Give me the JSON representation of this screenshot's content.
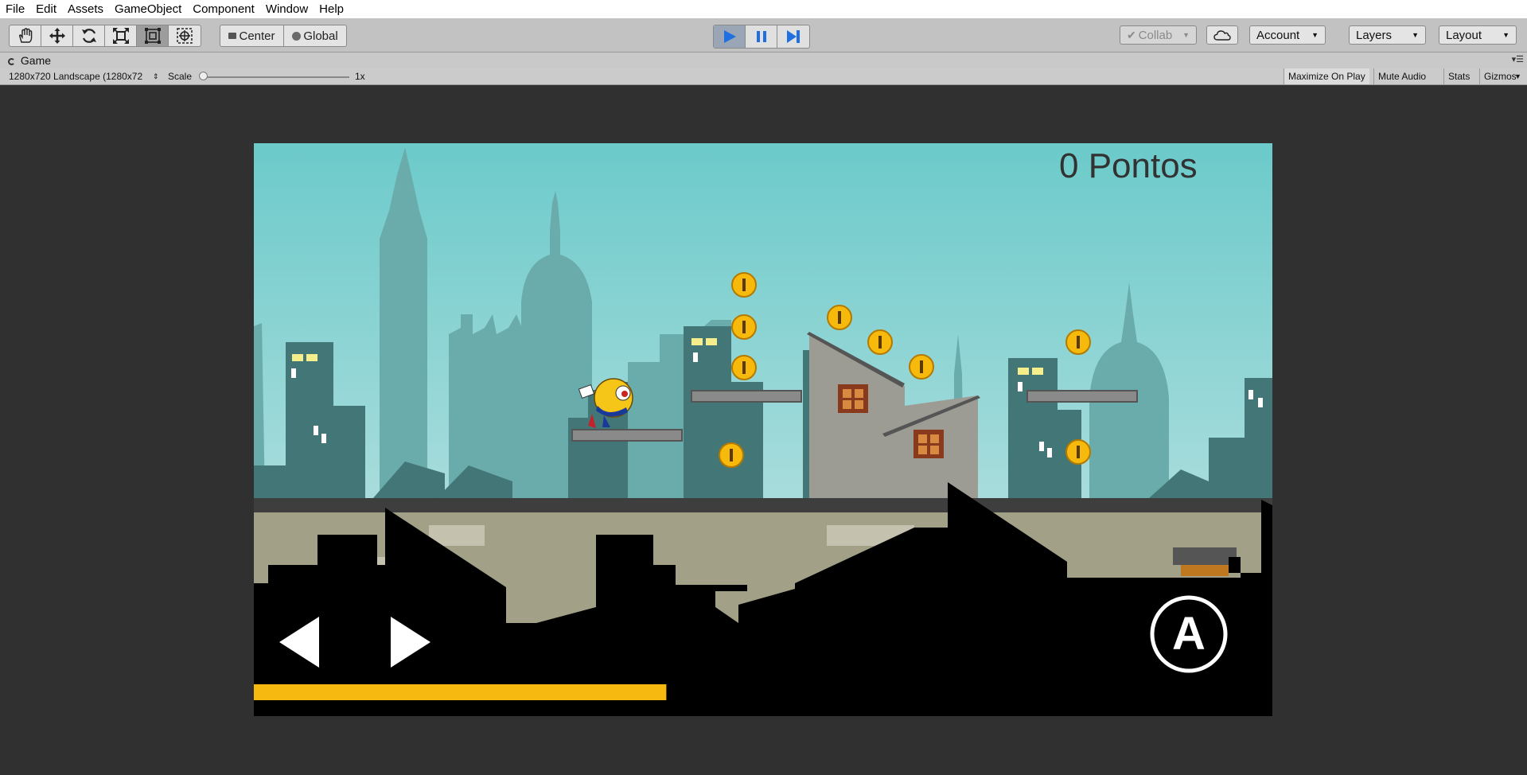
{
  "menu": [
    "File",
    "Edit",
    "Assets",
    "GameObject",
    "Component",
    "Window",
    "Help"
  ],
  "toolbar": {
    "tools": [
      {
        "icon": "hand-icon",
        "selected": false
      },
      {
        "icon": "move-icon",
        "selected": false
      },
      {
        "icon": "rotate-icon",
        "selected": false
      },
      {
        "icon": "scale-icon",
        "selected": false
      },
      {
        "icon": "rect-tool-icon",
        "selected": true
      },
      {
        "icon": "transform-icon",
        "selected": false
      }
    ],
    "pivot_label": "Center",
    "space_label": "Global",
    "play_active": true,
    "collab_label": "Collab",
    "account_label": "Account",
    "layers_label": "Layers",
    "layout_label": "Layout",
    "accent_color": "#1f6fe0"
  },
  "game_view": {
    "tab_label": "Game",
    "resolution": "1280x720 Landscape (1280x72",
    "scale_label": "Scale",
    "scale_value": "1x",
    "buttons": [
      "Maximize On Play",
      "Mute Audio",
      "Stats",
      "Gizmos"
    ]
  },
  "game": {
    "score_text": "0 Pontos",
    "action_button_label": "A",
    "progress": 0.405,
    "progress_color": "#f5b90f",
    "sky_color": "#70cccc"
  }
}
